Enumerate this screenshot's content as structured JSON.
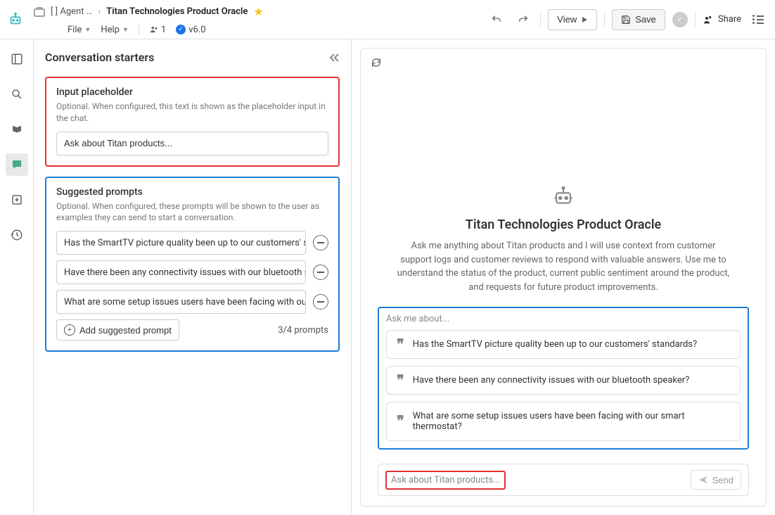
{
  "breadcrumb": {
    "folder": "[                 ] Agent …",
    "title": "Titan Technologies Product Oracle"
  },
  "menus": {
    "file": "File",
    "help": "Help",
    "users_count": "1",
    "version": "v6.0"
  },
  "toolbar": {
    "view": "View",
    "save": "Save",
    "share": "Share"
  },
  "panel": {
    "title": "Conversation starters"
  },
  "placeholder_section": {
    "title": "Input placeholder",
    "desc": "Optional. When configured, this text is shown as the placeholder input in the chat.",
    "value": "Ask about Titan products..."
  },
  "prompts_section": {
    "title": "Suggested prompts",
    "desc": "Optional. When configured, these prompts will be shown to the user as examples they can send to start a conversation.",
    "items": [
      "Has the SmartTV picture quality been up to our customers' sta",
      "Have there been any connectivity issues with our bluetooth sp",
      "What are some setup issues users have been facing with our sr"
    ],
    "add_label": "Add suggested prompt",
    "counter": "3/4 prompts"
  },
  "preview": {
    "title": "Titan Technologies Product Oracle",
    "desc": "Ask me anything about Titan products and I will use context from customer support logs and customer reviews to respond with valuable answers. Use me to understand the status of the product, current public sentiment around the product, and requests for future product improvements.",
    "ask_label": "Ask me about...",
    "prompts": [
      "Has the SmartTV picture quality been up to our customers' standards?",
      "Have there been any connectivity issues with our bluetooth speaker?",
      "What are some setup issues users have been facing with our smart thermostat?"
    ],
    "input_placeholder": "Ask about Titan products...",
    "send": "Send"
  }
}
